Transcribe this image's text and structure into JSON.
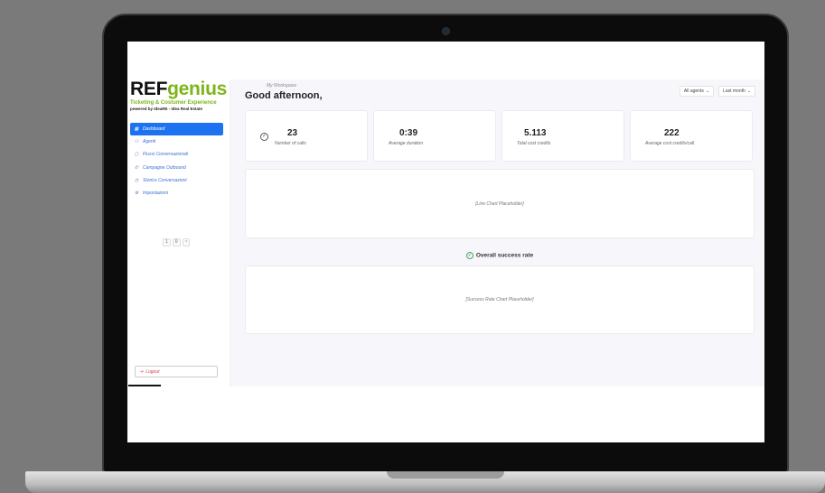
{
  "brand": {
    "name_part1": "REF",
    "name_part2": "genius",
    "tagline": "Ticketing & Costumer Experience",
    "powered_by": "powered by IdeaRE - Idea Real Estate"
  },
  "sidebar": {
    "items": [
      {
        "label": "Dashboard",
        "icon": "grid-icon",
        "active": true
      },
      {
        "label": "Agenti",
        "icon": "users-icon",
        "active": false
      },
      {
        "label": "Flussi Conversazionali",
        "icon": "flow-icon",
        "active": false
      },
      {
        "label": "Campagne Outbound",
        "icon": "phone-icon",
        "active": false
      },
      {
        "label": "Storico Conversazioni",
        "icon": "clock-icon",
        "active": false
      },
      {
        "label": "Impostazioni",
        "icon": "gear-icon",
        "active": false
      }
    ],
    "pager": {
      "prev": "1",
      "current": "0",
      "next": "~"
    },
    "logout_label": "Logout"
  },
  "header": {
    "breadcrumb": "My Workspace",
    "greeting": "Good afternoon,",
    "filters": [
      {
        "label": "All agents"
      },
      {
        "label": "Last month"
      }
    ]
  },
  "stats": [
    {
      "value": "23",
      "label": "Number of calls"
    },
    {
      "value": "0:39",
      "label": "Average duration"
    },
    {
      "value": "5.113",
      "label": "Total cost credits"
    },
    {
      "value": "222",
      "label": "Average cost credits/call"
    }
  ],
  "charts": {
    "line_placeholder": "[Line Chart Placeholder]",
    "success_title": "Overall success rate",
    "success_placeholder": "[Success Rate Chart Placeholder]"
  },
  "colors": {
    "accent": "#1d72f2",
    "brand_green": "#7cb518",
    "logout_red": "#d9434b"
  }
}
